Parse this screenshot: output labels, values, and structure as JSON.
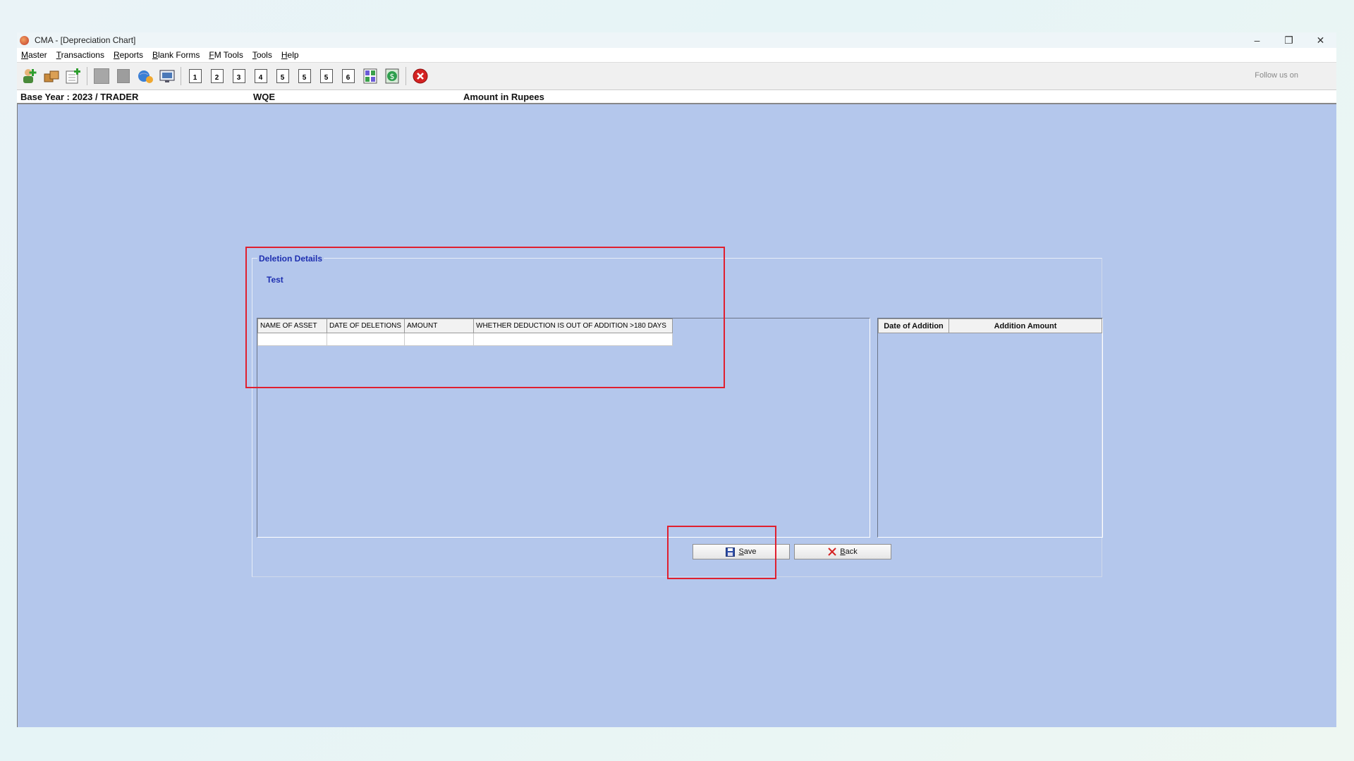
{
  "window": {
    "title": "CMA - [Depreciation Chart]",
    "controls": [
      "–",
      "❐",
      "✕"
    ]
  },
  "menu": {
    "items": [
      {
        "first": "M",
        "rest": "aster"
      },
      {
        "first": "T",
        "rest": "ransactions"
      },
      {
        "first": "R",
        "rest": "eports"
      },
      {
        "first": "B",
        "rest": "lank Forms"
      },
      {
        "first": "F",
        "rest": "M Tools"
      },
      {
        "first": "T",
        "rest": "ools"
      },
      {
        "first": "H",
        "rest": "elp"
      }
    ]
  },
  "toolbar": {
    "number_buttons": [
      "1",
      "2",
      "3",
      "4",
      "5",
      "5",
      "5",
      "6"
    ],
    "follow_text": "Follow us on"
  },
  "infobar": {
    "base_year": "Base Year : 2023 / TRADER",
    "company": "WQE",
    "amount_unit": "Amount in Rupees"
  },
  "dialog": {
    "legend": "Deletion Details",
    "subtitle": "Test",
    "deletion_columns": [
      "NAME OF ASSET",
      "DATE OF DELETIONS",
      "AMOUNT",
      "WHETHER DEDUCTION IS OUT OF ADDITION >180 DAYS"
    ],
    "addition_columns": [
      "Date of Addition",
      "Addition Amount"
    ],
    "save_label": "Save",
    "save_mnemonic": "S",
    "save_rest": "ave",
    "back_mnemonic": "B",
    "back_rest": "ack"
  },
  "colors": {
    "content_bg": "#b4c7ec",
    "label_blue": "#1e2fb0",
    "highlight": "#e0202f"
  }
}
